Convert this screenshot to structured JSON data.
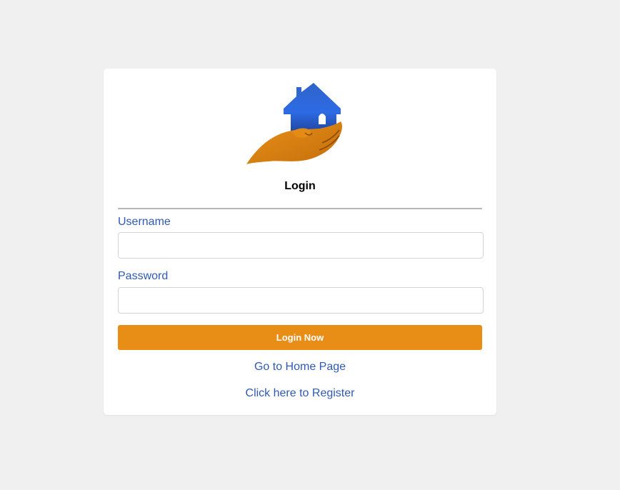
{
  "login_card": {
    "logo": "house-in-hand-logo",
    "title": "Login",
    "username": {
      "label": "Username",
      "value": "",
      "placeholder": ""
    },
    "password": {
      "label": "Password",
      "value": "",
      "placeholder": ""
    },
    "submit_label": "Login Now",
    "home_link": "Go to Home Page",
    "register_link": "Click here to Register"
  },
  "colors": {
    "page_background": "#f0f0f0",
    "card_background": "#ffffff",
    "accent_orange": "#e88e17",
    "link_blue": "#2f59b5",
    "logo_house_blue": "#2d6be6"
  }
}
